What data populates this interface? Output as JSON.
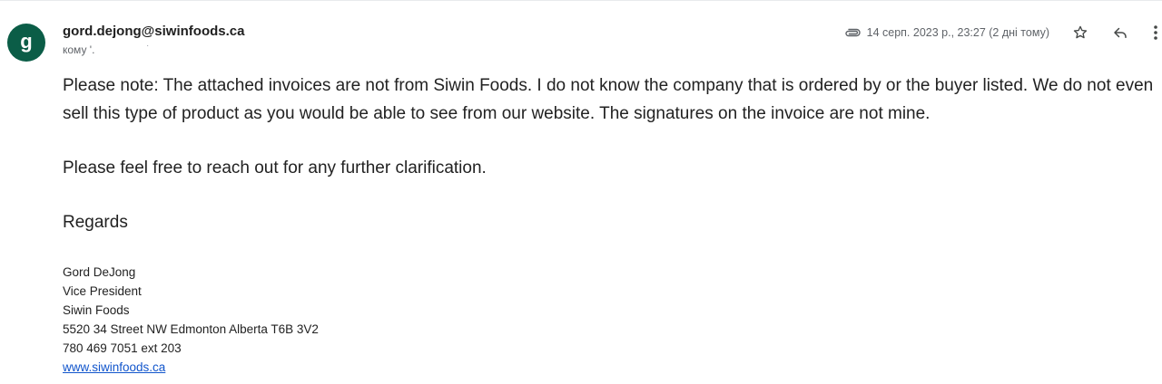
{
  "sender": {
    "avatar_letter": "g",
    "avatar_color": "#0b5d47",
    "email": "gord.dejong@siwinfoods.ca",
    "to_label": "кому",
    "to_value": "'."
  },
  "meta": {
    "attachment_icon": "paperclip-icon",
    "date": "14 серп. 2023 р., 23:27 (2 дні тому)",
    "star_icon": "star-icon",
    "reply_icon": "reply-icon",
    "more_icon": "more-vert-icon"
  },
  "body": {
    "paragraph1": "Please note: The attached invoices are not from Siwin Foods. I do not know the company that is ordered by or the buyer listed. We do not even sell this type of product as you would be able to see from our website. The signatures on the invoice are not mine.",
    "paragraph2": "Please feel free to reach out for any further clarification.",
    "paragraph3": "Regards"
  },
  "signature": {
    "name": "Gord DeJong",
    "title": "Vice President",
    "company": "Siwin Foods",
    "address": "5520 34 Street NW Edmonton Alberta T6B 3V2",
    "phone": "780 469 7051 ext 203",
    "website": "www.siwinfoods.ca",
    "link_color": "#1155cc"
  }
}
